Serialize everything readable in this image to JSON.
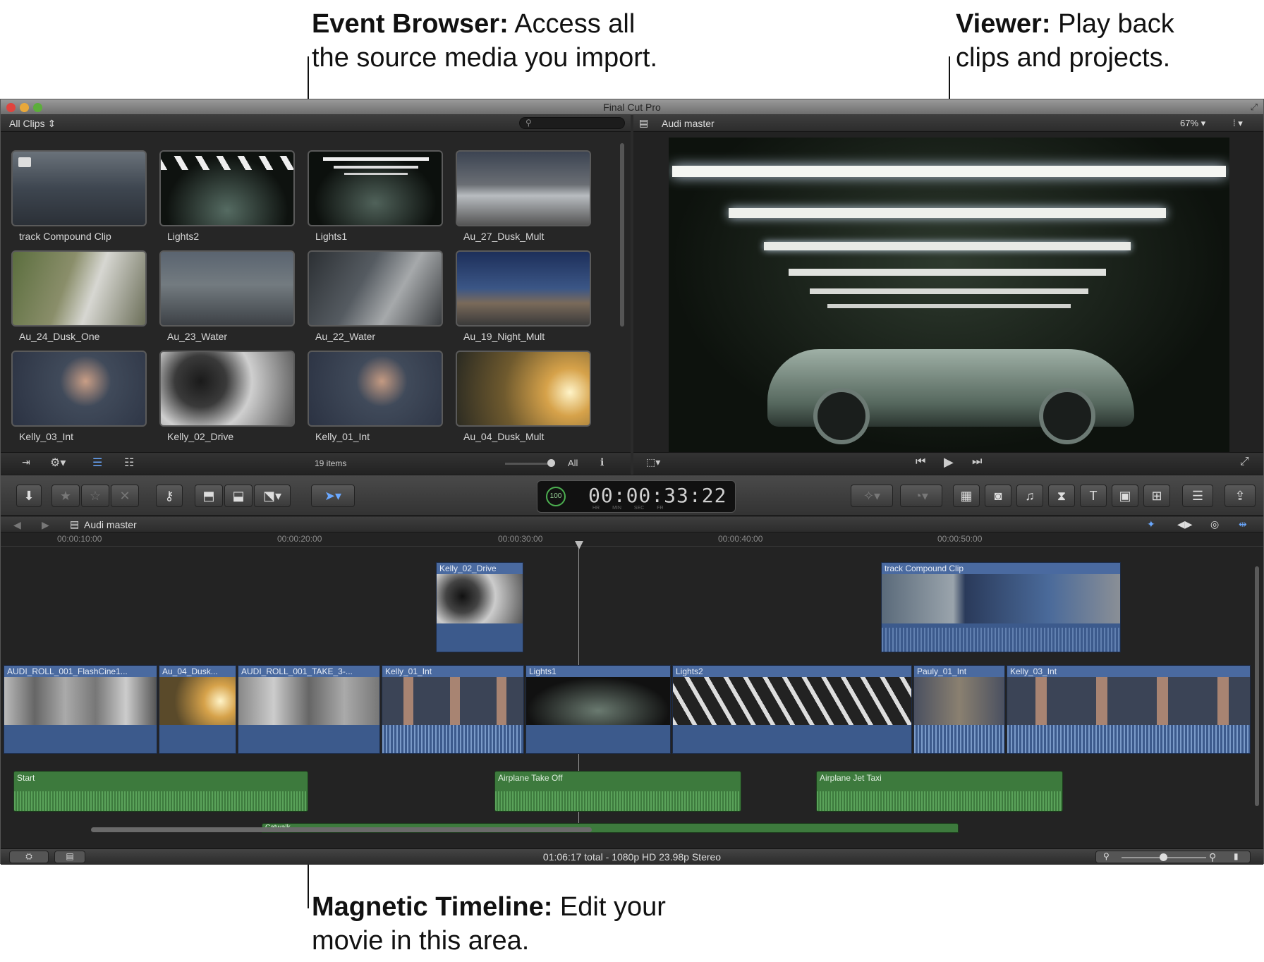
{
  "callouts": {
    "browser": {
      "bold": "Event Browser:",
      "text": " Access all",
      "line2": "the source media you import."
    },
    "viewer": {
      "bold": "Viewer:",
      "text": " Play back",
      "line2": "clips and projects."
    },
    "timeline": {
      "bold": "Magnetic Timeline:",
      "text": " Edit your",
      "line2": "movie in this area."
    }
  },
  "window": {
    "title": "Final Cut Pro"
  },
  "browser": {
    "filter": "All Clips",
    "item_count": "19 items",
    "show": "All",
    "clips": [
      {
        "label": "track Compound Clip"
      },
      {
        "label": "Lights2"
      },
      {
        "label": "Lights1"
      },
      {
        "label": "Au_27_Dusk_Mult"
      },
      {
        "label": "Au_24_Dusk_One"
      },
      {
        "label": "Au_23_Water"
      },
      {
        "label": "Au_22_Water"
      },
      {
        "label": "Au_19_Night_Mult"
      },
      {
        "label": "Kelly_03_Int"
      },
      {
        "label": "Kelly_02_Drive"
      },
      {
        "label": "Kelly_01_Int"
      },
      {
        "label": "Au_04_Dusk_Mult"
      }
    ]
  },
  "viewer": {
    "title": "Audi master",
    "zoom": "67%"
  },
  "toolbar": {
    "timecode": "00:00:33:22",
    "timecode_labels": [
      "HR",
      "MIN",
      "SEC",
      "FR"
    ],
    "speed": "100"
  },
  "timeline": {
    "project": "Audi master",
    "ruler": [
      "00:00:10:00",
      "00:00:20:00",
      "00:00:30:00",
      "00:00:40:00",
      "00:00:50:00"
    ],
    "connected_clips": [
      {
        "label": "Kelly_02_Drive"
      },
      {
        "label": "track Compound Clip"
      }
    ],
    "primary_clips": [
      {
        "label": "AUDI_ROLL_001_FlashCine1..."
      },
      {
        "label": "Au_04_Dusk..."
      },
      {
        "label": "AUDI_ROLL_001_TAKE_3-..."
      },
      {
        "label": "Kelly_01_Int"
      },
      {
        "label": "Lights1"
      },
      {
        "label": "Lights2"
      },
      {
        "label": "Pauly_01_Int"
      },
      {
        "label": "Kelly_03_Int"
      }
    ],
    "audio_clips": [
      {
        "label": "Start"
      },
      {
        "label": "Airplane Take Off"
      },
      {
        "label": "Airplane Jet Taxi"
      },
      {
        "label": "Catwalk"
      }
    ]
  },
  "status": {
    "summary": "01:06:17 total - 1080p HD 23.98p Stereo"
  }
}
